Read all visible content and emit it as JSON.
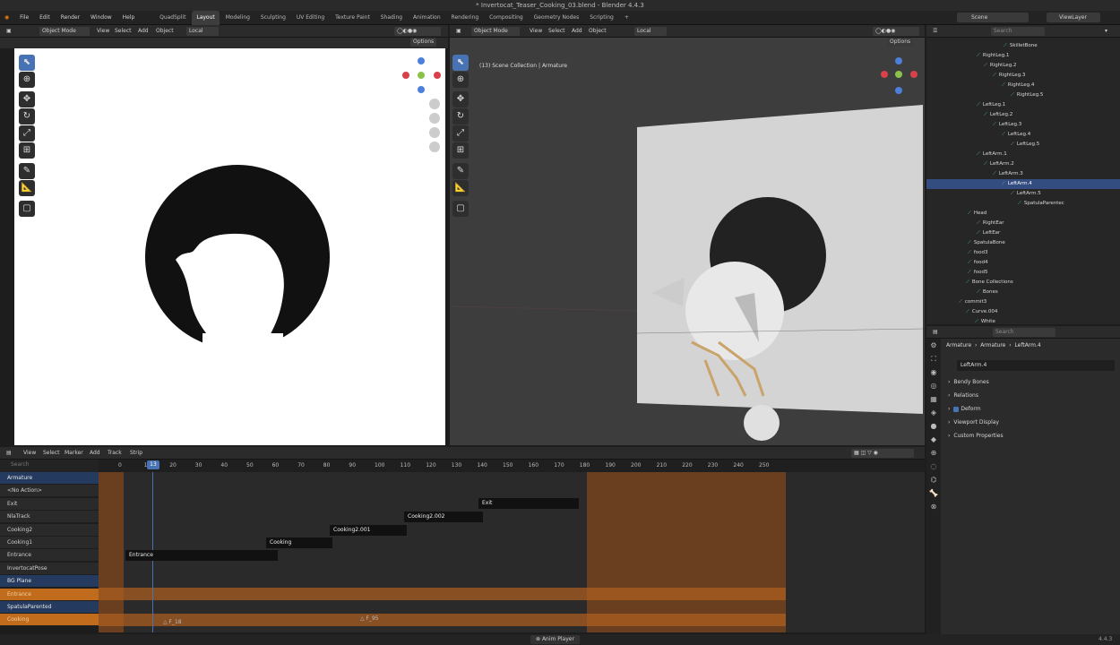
{
  "window": {
    "title": "* Invertocat_Teaser_Cooking_03.blend - Blender 4.4.3"
  },
  "menu": [
    "File",
    "Edit",
    "Render",
    "Window",
    "Help"
  ],
  "workspaces": [
    "QuadSplit",
    "Layout",
    "Modeling",
    "Sculpting",
    "UV Editing",
    "Texture Paint",
    "Shading",
    "Animation",
    "Rendering",
    "Compositing",
    "Geometry Nodes",
    "Scripting"
  ],
  "workspaces_add": "+",
  "active_workspace": "Layout",
  "scene": {
    "name": "Scene",
    "view_layer": "ViewLayer"
  },
  "left_view": {
    "mode": "Object Mode",
    "menus": [
      "View",
      "Select",
      "Add",
      "Object"
    ],
    "transform": "Local",
    "options": "Options"
  },
  "right_view": {
    "mode": "Object Mode",
    "menus": [
      "View",
      "Select",
      "Add",
      "Object"
    ],
    "transform": "Local",
    "options": "Options",
    "info_line1": "",
    "info_line2": "(13) Scene Collection | Armature"
  },
  "outliner": {
    "search_placeholder": "Search",
    "rows": [
      "SkilletBone",
      "RightLeg.1",
      "RightLeg.2",
      "RightLeg.3",
      "RightLeg.4",
      "RightLeg.5",
      "LeftLeg.1",
      "LeftLeg.2",
      "LeftLeg.3",
      "LeftLeg.4",
      "LeftLeg.5",
      "LeftArm.1",
      "LeftArm.2",
      "LeftArm.3",
      "LeftArm.4",
      "LeftArm.5",
      "SpatulaParentec",
      "Head",
      "RightEar",
      "LeftEar",
      "SpatulaBone",
      "food3",
      "food4",
      "food5",
      "Bone Collections",
      "Bones",
      "commit3",
      "Curve.004",
      "White"
    ],
    "selected": "LeftArm.4"
  },
  "properties": {
    "search_placeholder": "Search",
    "breadcrumb": [
      "Armature",
      "Armature",
      "LeftArm.4"
    ],
    "bone_name": "LeftArm.4",
    "panels": [
      "Bendy Bones",
      "Relations",
      "Deform",
      "Viewport Display",
      "Custom Properties"
    ]
  },
  "nla": {
    "menus": [
      "View",
      "Select",
      "Marker",
      "Add",
      "Track",
      "Strip"
    ],
    "search_placeholder": "Search",
    "current_frame": "13",
    "ticks": [
      "0",
      "10",
      "20",
      "30",
      "40",
      "50",
      "60",
      "70",
      "80",
      "90",
      "100",
      "110",
      "120",
      "130",
      "140",
      "150",
      "160",
      "170",
      "180",
      "190",
      "200",
      "210",
      "220",
      "230",
      "240",
      "250"
    ],
    "rows": [
      {
        "label": "Armature",
        "kind": "grp"
      },
      {
        "label": "<No Action>",
        "kind": "sub"
      },
      {
        "label": "Exit",
        "kind": "track"
      },
      {
        "label": "NlaTrack",
        "kind": "track"
      },
      {
        "label": "Cooking2",
        "kind": "track"
      },
      {
        "label": "Cooking1",
        "kind": "track"
      },
      {
        "label": "Entrance",
        "kind": "track"
      },
      {
        "label": "InvertocatPose",
        "kind": "track"
      },
      {
        "label": "BG Plane",
        "kind": "grp"
      },
      {
        "label": "Entrance",
        "kind": "act"
      },
      {
        "label": "SpatulaParented",
        "kind": "grp"
      },
      {
        "label": "Cooking",
        "kind": "act"
      }
    ],
    "strips": [
      {
        "label": "Entrance"
      },
      {
        "label": "Cooking"
      },
      {
        "label": "Cooking2.001"
      },
      {
        "label": "Cooking2.002"
      },
      {
        "label": "Exit"
      }
    ],
    "markers": [
      "F_18",
      "F_95"
    ]
  },
  "statusbar": {
    "center": "Anim Player",
    "version": "4.4.3"
  },
  "colors": {
    "accent": "#4772b3",
    "orange": "#c06c1c",
    "bone": "#4fc7a8"
  }
}
